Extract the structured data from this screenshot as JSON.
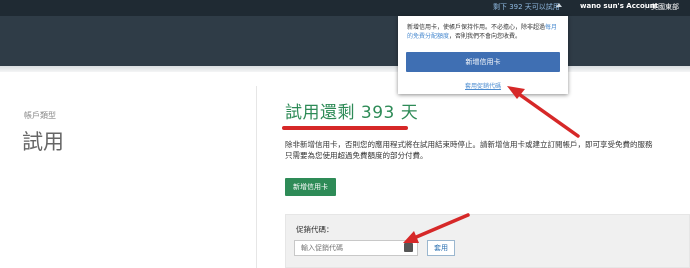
{
  "topbar": {
    "trial_link": "剩下 392 天可以試用",
    "account": "wano sun's Account",
    "separator": "|",
    "region": "美國東部"
  },
  "popup": {
    "message_part1": "新增信用卡，使帳戶保持作用。不必擔心，除非超過",
    "message_link": "每月的免費分配額度",
    "message_part2": "，否則我們不會向您收費。",
    "add_card_button": "新增信用卡",
    "promo_link": "套用促銷代碼"
  },
  "left": {
    "account_type_label": "帳戶類型",
    "account_type_value": "試用"
  },
  "main": {
    "heading": "試用還剩 393 天",
    "description_line1": "除非新增信用卡，否則您的應用程式將在試用結束時停止。請新增信用卡或建立訂閱帳戶，即可享受免費的服務",
    "description_line2": "只需要為您使用超過免費額度的部分付費。",
    "add_card_button": "新增信用卡",
    "promo_label": "促銷代碼：",
    "promo_placeholder": "輸入促銷代碼",
    "apply_button": "套用"
  },
  "colors": {
    "topbar": "#1f2a33",
    "navbar": "#2f3c47",
    "heading_green": "#2e8b57",
    "popup_button_blue": "#3f6fb3",
    "annotation_red": "#d62828"
  }
}
